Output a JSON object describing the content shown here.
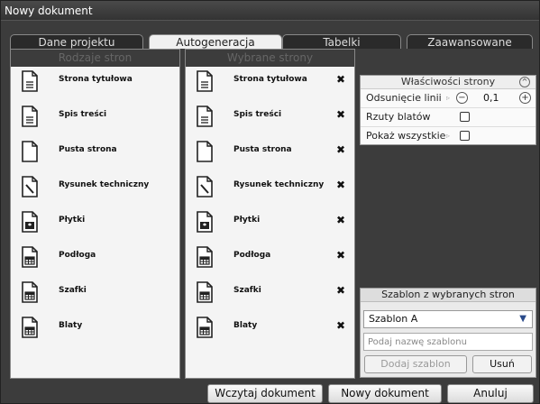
{
  "window": {
    "title": "Nowy dokument"
  },
  "tabs": [
    {
      "label": "Dane projektu"
    },
    {
      "label": "Autogeneracja"
    },
    {
      "label": "Tabelki"
    },
    {
      "label": "Zaawansowane"
    }
  ],
  "page_types": {
    "title": "Rodzaje stron",
    "items": [
      {
        "label": "Strona tytułowa",
        "icon": "text-document-icon"
      },
      {
        "label": "Spis treści",
        "icon": "text-document-icon"
      },
      {
        "label": "Pusta strona",
        "icon": "blank-document-icon"
      },
      {
        "label": "Rysunek techniczny",
        "icon": "drawing-document-icon"
      },
      {
        "label": "Płytki",
        "icon": "tiles-document-icon"
      },
      {
        "label": "Podłoga",
        "icon": "table-document-icon"
      },
      {
        "label": "Szafki",
        "icon": "table-document-icon"
      },
      {
        "label": "Blaty",
        "icon": "table-document-icon"
      }
    ]
  },
  "selected_pages": {
    "title": "Wybrane strony",
    "remove_symbol": "✖",
    "items": [
      {
        "label": "Strona tytułowa",
        "icon": "text-document-icon"
      },
      {
        "label": "Spis treści",
        "icon": "text-document-icon"
      },
      {
        "label": "Pusta strona",
        "icon": "blank-document-icon"
      },
      {
        "label": "Rysunek techniczny",
        "icon": "drawing-document-icon"
      },
      {
        "label": "Płytki",
        "icon": "tiles-document-icon"
      },
      {
        "label": "Podłoga",
        "icon": "table-document-icon"
      },
      {
        "label": "Szafki",
        "icon": "table-document-icon"
      },
      {
        "label": "Blaty",
        "icon": "table-document-icon"
      }
    ]
  },
  "properties": {
    "title": "Właściwości strony",
    "collapse_symbol": "^",
    "line_spacing_label": "Odsunięcie linii",
    "line_spacing_value": "0,1",
    "countertops_label": "Rzuty blatów",
    "countertops_checked": false,
    "show_all_label": "Pokaż wszystkie",
    "show_all_checked": false,
    "arrow_symbol": "▹"
  },
  "template": {
    "title": "Szablon z wybranych stron",
    "selected": "Szablon A",
    "name_placeholder": "Podaj nazwę szablonu",
    "add_label": "Dodaj szablon",
    "delete_label": "Usuń"
  },
  "footer": {
    "load_label": "Wczytaj dokument",
    "new_label": "Nowy dokument",
    "cancel_label": "Anuluj"
  },
  "colors": {
    "background": "#3c3c3c",
    "panel": "#f4f4f4",
    "accent": "#2a4a8a"
  }
}
